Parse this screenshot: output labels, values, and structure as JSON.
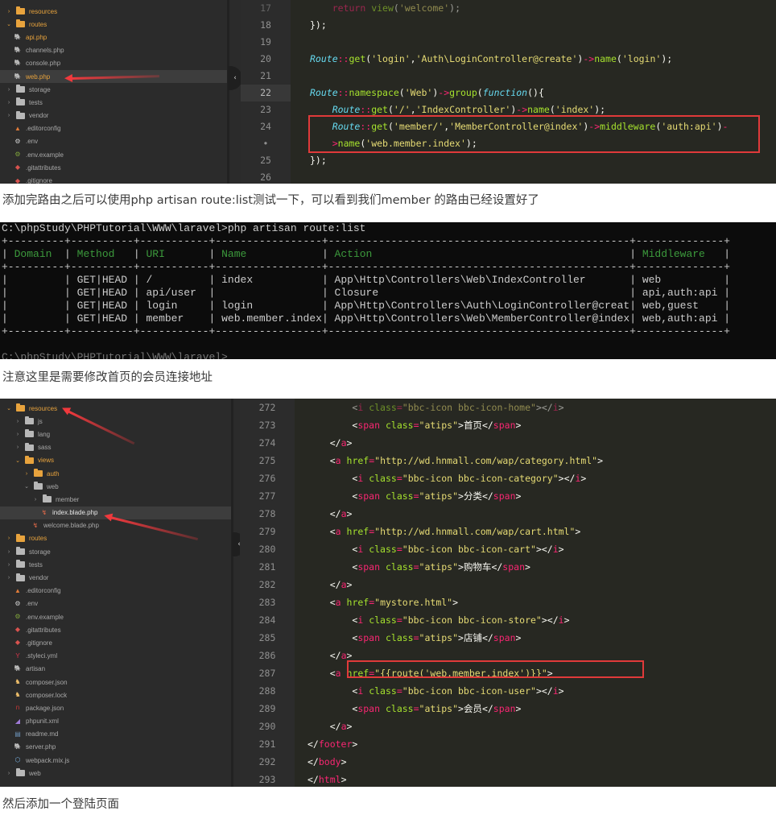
{
  "screenshot1": {
    "sidebar": {
      "items": [
        {
          "label": "resources",
          "type": "folder",
          "color": "orange",
          "expanded": false,
          "indent": 0
        },
        {
          "label": "routes",
          "type": "folder",
          "color": "orange",
          "expanded": true,
          "indent": 0
        },
        {
          "label": "api.php",
          "type": "file",
          "icon": "php-elephant-icon",
          "color": "orange",
          "indent": 1
        },
        {
          "label": "channels.php",
          "type": "file",
          "icon": "php-elephant-icon",
          "indent": 1
        },
        {
          "label": "console.php",
          "type": "file",
          "icon": "php-elephant-icon",
          "indent": 1
        },
        {
          "label": "web.php",
          "type": "file",
          "icon": "php-elephant-icon",
          "color": "orange",
          "indent": 1,
          "selected": true
        },
        {
          "label": "storage",
          "type": "folder",
          "expanded": false,
          "indent": 0
        },
        {
          "label": "tests",
          "type": "folder",
          "expanded": false,
          "indent": 0
        },
        {
          "label": "vendor",
          "type": "folder",
          "expanded": false,
          "indent": 0
        },
        {
          "label": ".editorconfig",
          "type": "file",
          "icon": "editorconfig-icon",
          "indent": 1
        },
        {
          "label": ".env",
          "type": "file",
          "icon": "gear-icon",
          "indent": 1
        },
        {
          "label": ".env.example",
          "type": "file",
          "icon": "gear-outline-icon",
          "indent": 1
        },
        {
          "label": ".gitattributes",
          "type": "file",
          "icon": "git-icon",
          "indent": 1
        },
        {
          "label": ".gitignore",
          "type": "file",
          "icon": "git-icon",
          "indent": 1
        }
      ]
    },
    "line_numbers": [
      "17",
      "18",
      "19",
      "20",
      "21",
      "22",
      "23",
      "24",
      "•",
      "25",
      "26"
    ],
    "active_line": "22",
    "code_lines": [
      "    return view('welcome');",
      "});",
      "",
      "Route::get('login','Auth\\LoginController@create')->name('login');",
      "",
      "Route::namespace('Web')->group(function(){",
      "    Route::get('/','IndexController')->name('index');",
      "    Route::get('member/','MemberController@index')->middleware('auth:api')-",
      "    >name('web.member.index');",
      "});",
      ""
    ]
  },
  "caption1": "添加完路由之后可以使用php artisan route:list测试一下，可以看到我们member 的路由已经设置好了",
  "terminal": {
    "prompt": "C:\\phpStudy\\PHPTutorial\\WWW\\laravel>php artisan route:list",
    "headers": [
      "Domain",
      "Method",
      "URI",
      "Name",
      "Action",
      "Middleware"
    ],
    "rows": [
      {
        "domain": "",
        "method": "GET|HEAD",
        "uri": "/",
        "name": "index",
        "action": "App\\Http\\Controllers\\Web\\IndexController",
        "middleware": "web"
      },
      {
        "domain": "",
        "method": "GET|HEAD",
        "uri": "api/user",
        "name": "",
        "action": "Closure",
        "middleware": "api,auth:api"
      },
      {
        "domain": "",
        "method": "GET|HEAD",
        "uri": "login",
        "name": "login",
        "action": "App\\Http\\Controllers\\Auth\\LoginController@create",
        "middleware": "web,guest"
      },
      {
        "domain": "",
        "method": "GET|HEAD",
        "uri": "member",
        "name": "web.member.index",
        "action": "App\\Http\\Controllers\\Web\\MemberController@index",
        "middleware": "web,auth:api"
      }
    ],
    "next_prompt_partial": "C:\\phpStudy\\PHPTutorial\\WWW\\laravel>"
  },
  "caption2": "注意这里是需要修改首页的会员连接地址",
  "screenshot2": {
    "sidebar": {
      "items": [
        {
          "label": "resources",
          "type": "folder",
          "color": "orange",
          "expanded": true,
          "indent": 0
        },
        {
          "label": "js",
          "type": "folder",
          "expanded": false,
          "indent": 1
        },
        {
          "label": "lang",
          "type": "folder",
          "expanded": false,
          "indent": 1
        },
        {
          "label": "sass",
          "type": "folder",
          "expanded": false,
          "indent": 1
        },
        {
          "label": "views",
          "type": "folder",
          "color": "orange",
          "expanded": true,
          "indent": 1
        },
        {
          "label": "auth",
          "type": "folder",
          "color": "orange",
          "expanded": false,
          "indent": 2
        },
        {
          "label": "web",
          "type": "folder",
          "expanded": true,
          "indent": 2
        },
        {
          "label": "member",
          "type": "folder",
          "expanded": false,
          "indent": 3
        },
        {
          "label": "index.blade.php",
          "type": "file",
          "icon": "blade-icon",
          "color": "white",
          "indent": 4,
          "selected": true
        },
        {
          "label": "welcome.blade.php",
          "type": "file",
          "icon": "blade-icon",
          "indent": 3
        },
        {
          "label": "routes",
          "type": "folder",
          "color": "orange",
          "expanded": false,
          "indent": 0
        },
        {
          "label": "storage",
          "type": "folder",
          "expanded": false,
          "indent": 0
        },
        {
          "label": "tests",
          "type": "folder",
          "expanded": false,
          "indent": 0
        },
        {
          "label": "vendor",
          "type": "folder",
          "expanded": false,
          "indent": 0
        },
        {
          "label": ".editorconfig",
          "type": "file",
          "icon": "editorconfig-icon",
          "indent": 1
        },
        {
          "label": ".env",
          "type": "file",
          "icon": "gear-icon",
          "indent": 1
        },
        {
          "label": ".env.example",
          "type": "file",
          "icon": "gear-outline-icon",
          "indent": 1
        },
        {
          "label": ".gitattributes",
          "type": "file",
          "icon": "git-icon",
          "indent": 1
        },
        {
          "label": ".gitignore",
          "type": "file",
          "icon": "git-icon",
          "indent": 1
        },
        {
          "label": ".styleci.yml",
          "type": "file",
          "icon": "styleci-icon",
          "indent": 1
        },
        {
          "label": "artisan",
          "type": "file",
          "icon": "php-elephant-icon",
          "indent": 1
        },
        {
          "label": "composer.json",
          "type": "file",
          "icon": "composer-icon",
          "indent": 1
        },
        {
          "label": "composer.lock",
          "type": "file",
          "icon": "composer-icon",
          "indent": 1
        },
        {
          "label": "package.json",
          "type": "file",
          "icon": "npm-icon",
          "indent": 1
        },
        {
          "label": "phpunit.xml",
          "type": "file",
          "icon": "phpunit-icon",
          "indent": 1
        },
        {
          "label": "readme.md",
          "type": "file",
          "icon": "markdown-icon",
          "indent": 1
        },
        {
          "label": "server.php",
          "type": "file",
          "icon": "php-elephant-icon",
          "indent": 1
        },
        {
          "label": "webpack.mix.js",
          "type": "file",
          "icon": "webpack-icon",
          "indent": 1
        },
        {
          "label": "web",
          "type": "folder",
          "expanded": false,
          "indent": 0
        }
      ]
    },
    "line_numbers": [
      "272",
      "273",
      "274",
      "275",
      "276",
      "277",
      "278",
      "279",
      "280",
      "281",
      "282",
      "283",
      "284",
      "285",
      "286",
      "287",
      "288",
      "289",
      "290",
      "291",
      "292",
      "293"
    ],
    "code_lines": [
      "        <i class=\"bbc-icon bbc-icon-home\"></i>",
      "        <span class=\"atips\">首页</span>",
      "    </a>",
      "    <a href=\"http://wd.hnmall.com/wap/category.html\">",
      "        <i class=\"bbc-icon bbc-icon-category\"></i>",
      "        <span class=\"atips\">分类</span>",
      "    </a>",
      "    <a href=\"http://wd.hnmall.com/wap/cart.html\">",
      "        <i class=\"bbc-icon bbc-icon-cart\"></i>",
      "        <span class=\"atips\">购物车</span>",
      "    </a>",
      "    <a href=\"mystore.html\">",
      "        <i class=\"bbc-icon bbc-icon-store\"></i>",
      "        <span class=\"atips\">店铺</span>",
      "    </a>",
      "    <a href=\"{{route('web.member.index')}}\">",
      "        <i class=\"bbc-icon bbc-icon-user\"></i>",
      "        <span class=\"atips\">会员</span>",
      "    </a>",
      "</footer>",
      "</body>",
      "</html>"
    ]
  },
  "caption3": "然后添加一个登陆页面",
  "colors": {
    "editor_bg": "#272822",
    "sidebar_bg": "#2b2b2b",
    "highlight_box": "#e03a3a",
    "arrow": "#f0393d",
    "folder_orange": "#e8a33d",
    "terminal_bg": "#0c0c0c",
    "terminal_header": "#3c9a3c"
  }
}
